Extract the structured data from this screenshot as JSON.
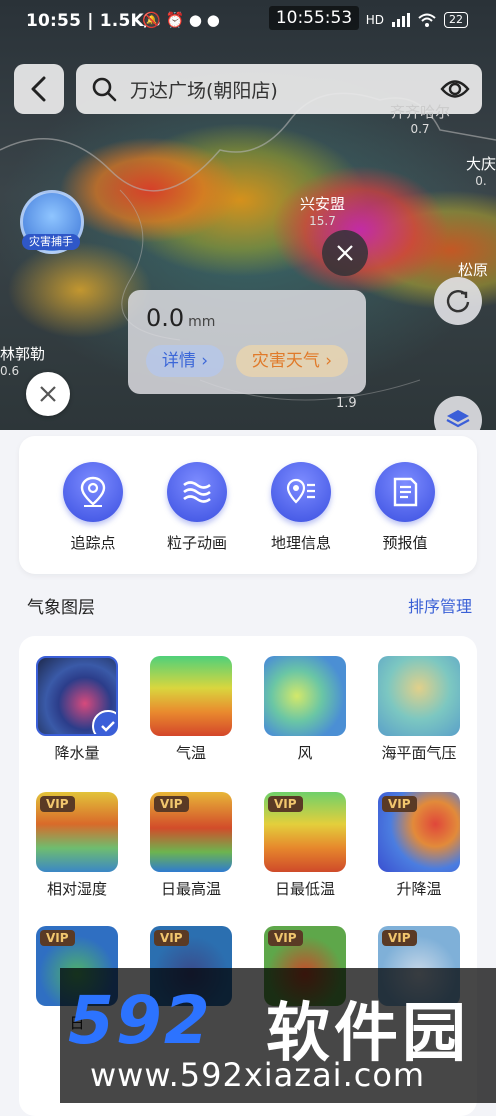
{
  "status": {
    "time": "10:55",
    "speed": "1.5K/s",
    "center_time": "10:55:53",
    "network": "HD",
    "battery": "22"
  },
  "search": {
    "text": "万达广场(朝阳店)"
  },
  "map": {
    "labels": [
      {
        "name": "兴安盟",
        "value": "15.7"
      },
      {
        "name": "齐齐哈尔",
        "value": "0.7"
      },
      {
        "name": "大庆",
        "value": "0."
      },
      {
        "name": "松原",
        "value": ""
      },
      {
        "name": "林郭勒",
        "value": "0.6"
      }
    ],
    "scale_value": "1.9",
    "disaster_badge": "灾害捕手"
  },
  "popup": {
    "value": "0.0",
    "unit": "mm",
    "details": "详情 ›",
    "disaster": "灾害天气 ›"
  },
  "tools": [
    {
      "label": "追踪点",
      "icon": "location-pin-icon"
    },
    {
      "label": "粒子动画",
      "icon": "waves-icon"
    },
    {
      "label": "地理信息",
      "icon": "map-list-icon"
    },
    {
      "label": "预报值",
      "icon": "document-icon"
    }
  ],
  "layers_section": {
    "title": "气象图层",
    "manage": "排序管理"
  },
  "layers": [
    {
      "label": "降水量",
      "vip": false,
      "selected": true
    },
    {
      "label": "气温",
      "vip": false,
      "selected": false
    },
    {
      "label": "风",
      "vip": false,
      "selected": false
    },
    {
      "label": "海平面气压",
      "vip": false,
      "selected": false
    },
    {
      "label": "相对湿度",
      "vip": true,
      "selected": false
    },
    {
      "label": "日最高温",
      "vip": true,
      "selected": false
    },
    {
      "label": "日最低温",
      "vip": true,
      "selected": false
    },
    {
      "label": "升降温",
      "vip": true,
      "selected": false
    },
    {
      "label": "日",
      "vip": true,
      "selected": false
    },
    {
      "label": "",
      "vip": true,
      "selected": false
    },
    {
      "label": "",
      "vip": true,
      "selected": false
    },
    {
      "label": "",
      "vip": true,
      "selected": false
    }
  ],
  "vip_text": "VIP",
  "watermark": {
    "big": "592",
    "big2": "软件园",
    "url": "www.592xiazai.com"
  }
}
